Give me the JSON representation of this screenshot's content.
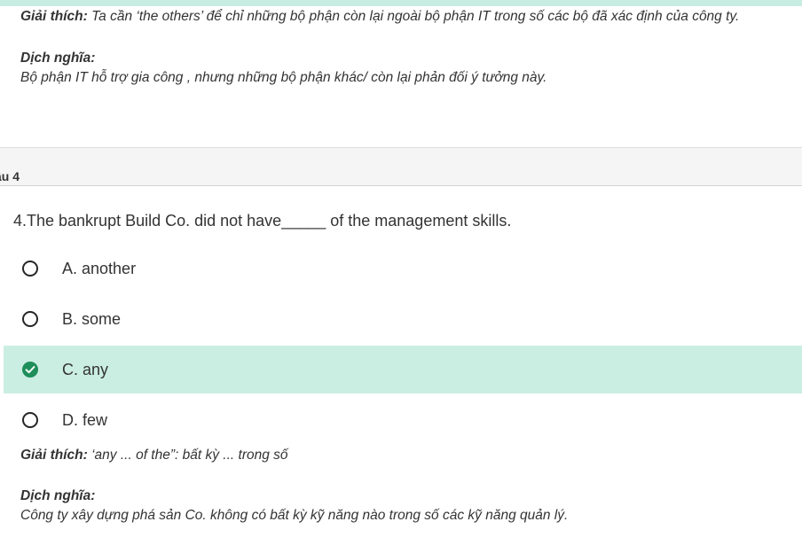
{
  "prev_explanation": {
    "label": "Giải thích:",
    "text": "Ta cần ‘the others’ để chỉ những bộ phận còn lại ngoài bộ phận IT trong số các bộ đã xác định của công ty."
  },
  "prev_translation": {
    "label": "Dịch nghĩa:",
    "text": "Bộ phận IT hỗ trợ gia công , nhưng những bộ phận khác/ còn lại phản đối ý tưởng này."
  },
  "section": {
    "title": "âu 4"
  },
  "question": {
    "text": "4.The bankrupt Build Co. did not have_____ of the management skills."
  },
  "options": [
    {
      "label": "A. another",
      "selected": false
    },
    {
      "label": "B. some",
      "selected": false
    },
    {
      "label": "C. any",
      "selected": true
    },
    {
      "label": "D. few",
      "selected": false
    }
  ],
  "explanation": {
    "label": "Giải thích:",
    "text": "‘any ... of the”: bất kỳ ... trong số"
  },
  "translation": {
    "label": "Dịch nghĩa:",
    "text": "Công ty xây dựng phá sản Co. không có bất kỳ kỹ năng nào trong số các kỹ năng quản lý."
  },
  "colors": {
    "selected_bg": "#cbeee3",
    "check_green": "#1e8e5a",
    "top_strip": "#c8ece2"
  }
}
